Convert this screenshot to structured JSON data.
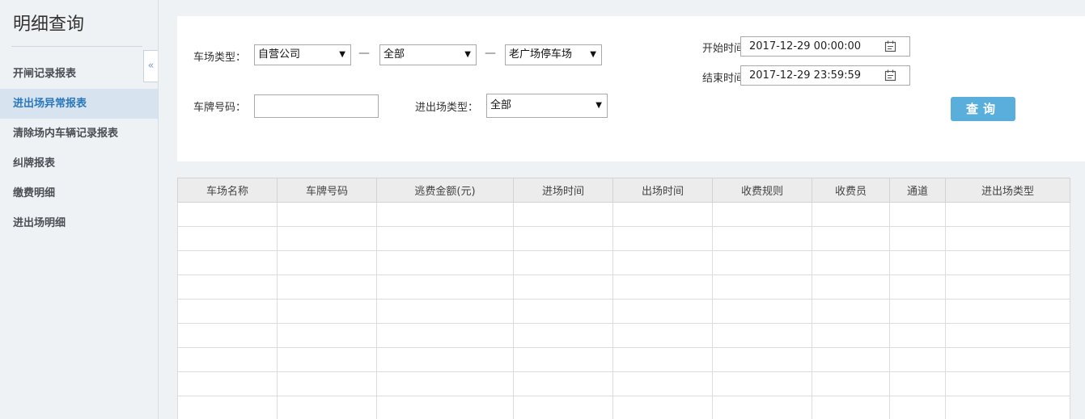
{
  "sidebar": {
    "title": "明细查询",
    "collapse_icon": "«",
    "items": [
      {
        "label": "开闸记录报表",
        "active": false
      },
      {
        "label": "进出场异常报表",
        "active": true
      },
      {
        "label": "清除场内车辆记录报表",
        "active": false
      },
      {
        "label": "纠牌报表",
        "active": false
      },
      {
        "label": "缴费明细",
        "active": false
      },
      {
        "label": "进出场明细",
        "active": false
      }
    ]
  },
  "filters": {
    "lot_type_label": "车场类型：",
    "lot_type_value": "自营公司",
    "region_value": "全部",
    "lot_value": "老广场停车场",
    "separator": "—",
    "plate_label": "车牌号码：",
    "plate_value": "",
    "inout_type_label": "进出场类型：",
    "inout_type_value": "全部",
    "start_label": "开始时间：",
    "start_value": "2017-12-29 00:00:00",
    "end_label": "结束时间：",
    "end_value": "2017-12-29 23:59:59",
    "query_label": "查询"
  },
  "table": {
    "columns": [
      "车场名称",
      "车牌号码",
      "逃费金额(元)",
      "进场时间",
      "出场时间",
      "收费规则",
      "收费员",
      "通道",
      "进出场类型"
    ],
    "rows": []
  },
  "colors": {
    "accent": "#5aaedc",
    "active_nav_bg": "#d7e3ee",
    "active_nav_text": "#2a77b9"
  }
}
